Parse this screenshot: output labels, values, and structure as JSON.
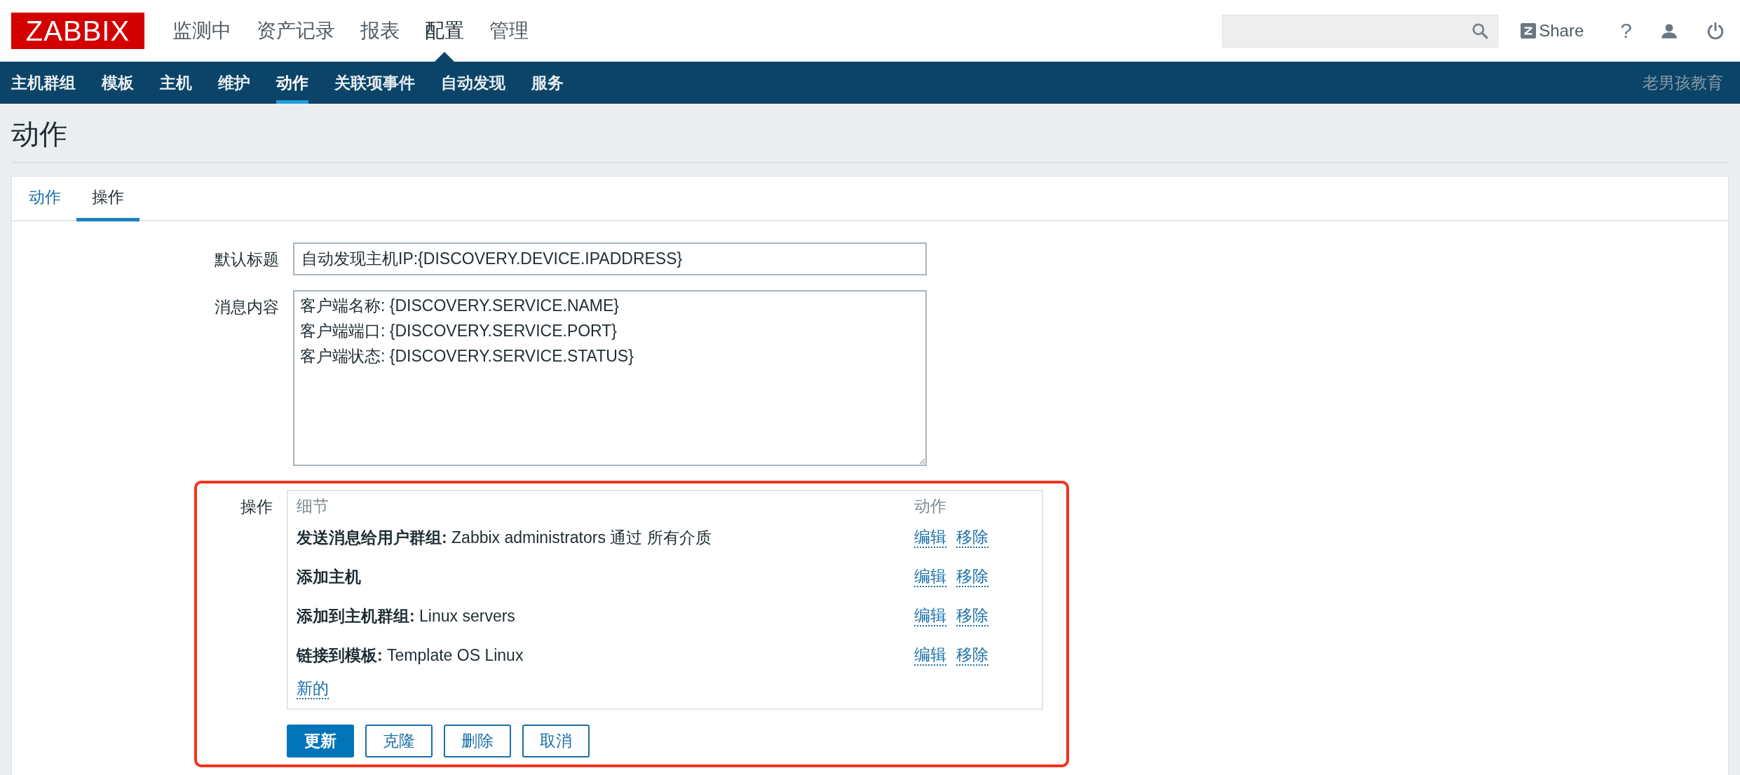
{
  "header": {
    "logo": "ZABBIX",
    "menu": [
      {
        "label": "监测中",
        "selected": false
      },
      {
        "label": "资产记录",
        "selected": false
      },
      {
        "label": "报表",
        "selected": false
      },
      {
        "label": "配置",
        "selected": true
      },
      {
        "label": "管理",
        "selected": false
      }
    ],
    "share": "Share",
    "help": "?"
  },
  "subnav": {
    "items": [
      {
        "label": "主机群组",
        "selected": false
      },
      {
        "label": "模板",
        "selected": false
      },
      {
        "label": "主机",
        "selected": false
      },
      {
        "label": "维护",
        "selected": false
      },
      {
        "label": "动作",
        "selected": true
      },
      {
        "label": "关联项事件",
        "selected": false
      },
      {
        "label": "自动发现",
        "selected": false
      },
      {
        "label": "服务",
        "selected": false
      }
    ],
    "brand": "老男孩教育"
  },
  "page_title": "动作",
  "tabs": [
    {
      "label": "动作",
      "selected": false
    },
    {
      "label": "操作",
      "selected": true
    }
  ],
  "form": {
    "default_subject": {
      "label": "默认标题",
      "value": "自动发现主机IP:{DISCOVERY.DEVICE.IPADDRESS}"
    },
    "message": {
      "label": "消息内容",
      "value": "客户端名称: {DISCOVERY.SERVICE.NAME}\n客户端端口: {DISCOVERY.SERVICE.PORT}\n客户端状态: {DISCOVERY.SERVICE.STATUS}"
    },
    "operations": {
      "label": "操作",
      "columns": [
        "细节",
        "动作"
      ],
      "rows": [
        {
          "detail": "**发送消息给用户群组:** Zabbix administrators 通过 所有介质",
          "actions": [
            "编辑",
            "移除"
          ]
        },
        {
          "detail": "**添加主机**",
          "actions": [
            "编辑",
            "移除"
          ]
        },
        {
          "detail": "**添加到主机群组:** Linux servers",
          "actions": [
            "编辑",
            "移除"
          ]
        },
        {
          "detail": "**链接到模板:** Template OS Linux",
          "actions": [
            "编辑",
            "移除"
          ]
        }
      ],
      "new_link": "新的"
    },
    "buttons": [
      {
        "label": "更新",
        "kind": "primary"
      },
      {
        "label": "克隆",
        "kind": "secondary"
      },
      {
        "label": "删除",
        "kind": "secondary"
      },
      {
        "label": "取消",
        "kind": "secondary"
      }
    ]
  }
}
